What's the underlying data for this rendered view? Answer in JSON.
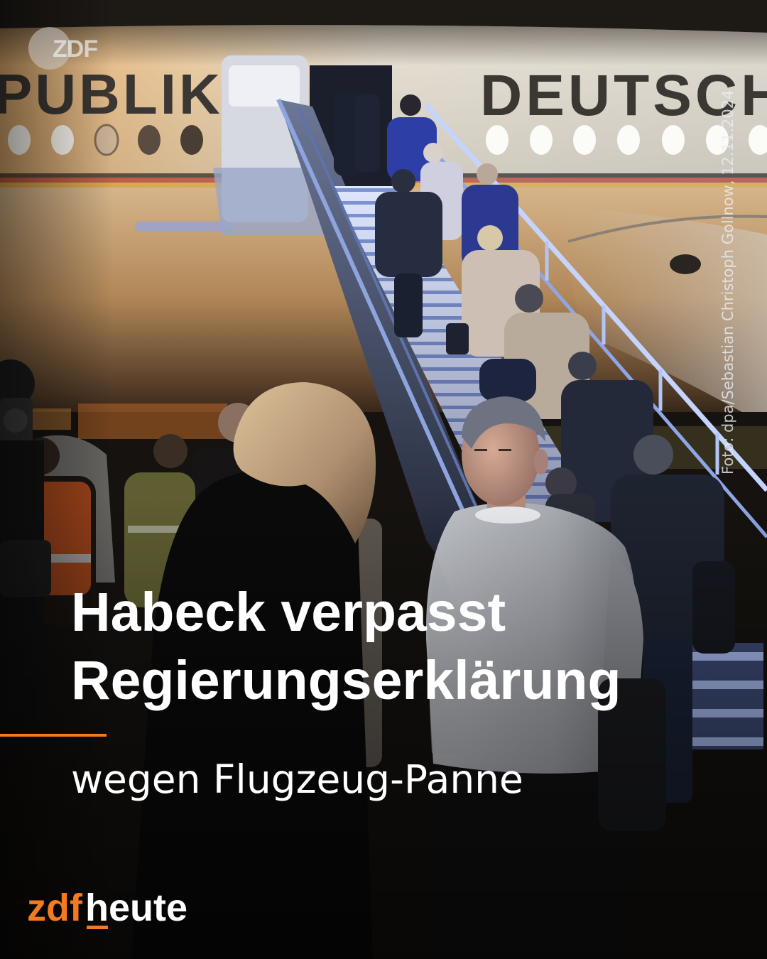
{
  "brand": {
    "logo_top": "ZDF",
    "logo_bottom_part1": "zdf",
    "logo_bottom_part2": "heute"
  },
  "photo": {
    "plane_lettering_left": "PUBLIK",
    "plane_lettering_right": "DEUTSCH"
  },
  "credit": "Foto: dpa/Sebastian Christoph Gollnow, 12.11.2024",
  "headline": {
    "line1": "Habeck verpasst",
    "line2": "Regierungserklärung"
  },
  "subline": "wegen Flugzeug-Panne",
  "colors": {
    "accent": "#f47a1f",
    "text": "#ffffff"
  }
}
